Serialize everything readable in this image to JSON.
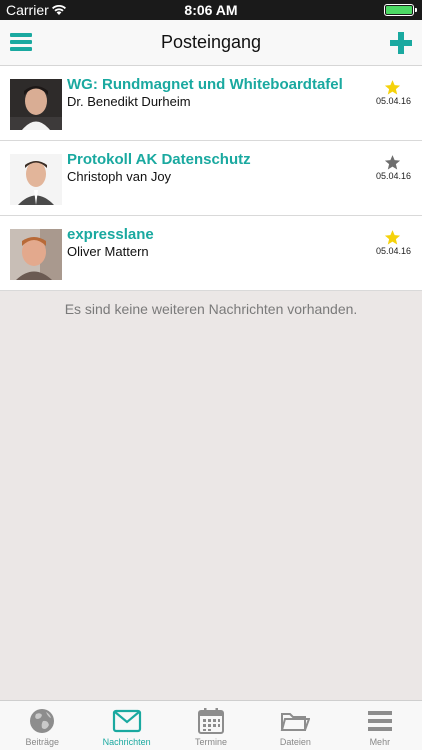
{
  "status_bar": {
    "carrier": "Carrier",
    "time": "8:06 AM"
  },
  "nav": {
    "title": "Posteingang"
  },
  "messages": [
    {
      "subject": "WG: Rundmagnet und Whiteboardtafel",
      "sender": "Dr. Benedikt Durheim",
      "date": "05.04.16",
      "starred": true
    },
    {
      "subject": "Protokoll AK Datenschutz",
      "sender": "Christoph van Joy",
      "date": "05.04.16",
      "starred": false
    },
    {
      "subject": "expresslane",
      "sender": "Oliver Mattern",
      "date": "05.04.16",
      "starred": true
    }
  ],
  "empty_note": "Es sind keine weiteren Nachrichten vorhanden.",
  "tabs": [
    {
      "label": "Beiträge",
      "icon": "globe-icon"
    },
    {
      "label": "Nachrichten",
      "icon": "envelope-icon",
      "active": true
    },
    {
      "label": "Termine",
      "icon": "calendar-icon"
    },
    {
      "label": "Dateien",
      "icon": "folder-icon"
    },
    {
      "label": "Mehr",
      "icon": "menu-icon"
    }
  ],
  "colors": {
    "accent": "#1aa9a0",
    "star_active": "#f5d20a",
    "star_inactive": "#6e6e6e",
    "background": "#ebe7e6"
  }
}
